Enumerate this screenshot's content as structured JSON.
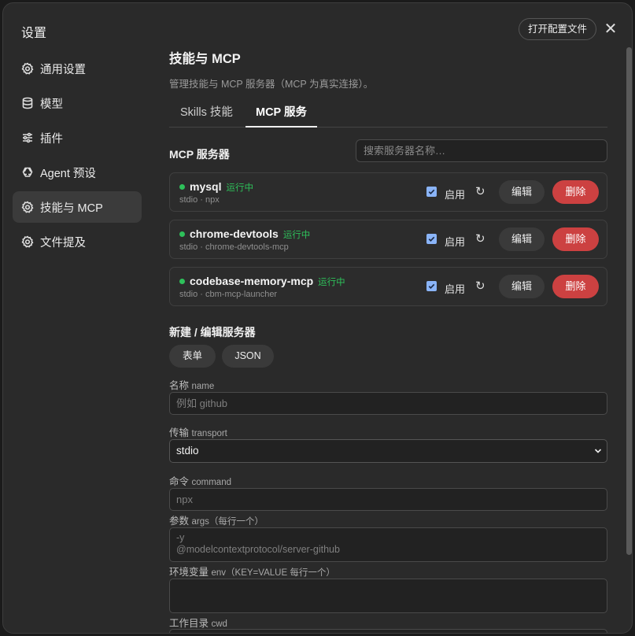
{
  "window": {
    "title": "设置",
    "open_config_label": "打开配置文件",
    "close_glyph": "✕"
  },
  "sidebar": {
    "items": [
      {
        "label": "通用设置",
        "icon": "gear-icon"
      },
      {
        "label": "模型",
        "icon": "database-icon"
      },
      {
        "label": "插件",
        "icon": "sliders-icon"
      },
      {
        "label": "Agent 预设",
        "icon": "recycle-icon"
      },
      {
        "label": "技能与 MCP",
        "icon": "gear-icon",
        "active": true
      },
      {
        "label": "文件提及",
        "icon": "gear-icon"
      }
    ]
  },
  "main": {
    "title": "技能与 MCP",
    "subtitle": "管理技能与 MCP 服务器（MCP 为真实连接）。",
    "tabs": [
      {
        "label": "Skills 技能"
      },
      {
        "label": "MCP 服务",
        "active": true
      }
    ],
    "servers_section_title": "MCP 服务器",
    "search_placeholder": "搜索服务器名称…",
    "enable_label": "启用",
    "refresh_glyph": "↻",
    "edit_label": "编辑",
    "delete_label": "删除",
    "servers": [
      {
        "name": "mysql",
        "status": "运行中",
        "sub": "stdio · npx",
        "enabled": true
      },
      {
        "name": "chrome-devtools",
        "status": "运行中",
        "sub": "stdio · chrome-devtools-mcp",
        "enabled": true
      },
      {
        "name": "codebase-memory-mcp",
        "status": "运行中",
        "sub": "stdio · cbm-mcp-launcher",
        "enabled": true
      }
    ],
    "editor": {
      "title": "新建 / 编辑服务器",
      "mode_form": "表单",
      "mode_json": "JSON",
      "name_label": "名称",
      "name_label_en": "name",
      "name_placeholder": "例如 github",
      "transport_label": "传输",
      "transport_label_en": "transport",
      "transport_value": "stdio",
      "command_label": "命令",
      "command_label_en": "command",
      "command_placeholder": "npx",
      "args_label": "参数",
      "args_label_en": "args（每行一个）",
      "args_placeholder": "-y\n@modelcontextprotocol/server-github",
      "env_label": "环境变量",
      "env_label_en": "env（KEY=VALUE 每行一个）",
      "cwd_label": "工作目录",
      "cwd_label_en": "cwd"
    }
  },
  "colors": {
    "running": "#2ec05a",
    "delete": "#cc4141",
    "checkbox": "#8ab4f8"
  }
}
